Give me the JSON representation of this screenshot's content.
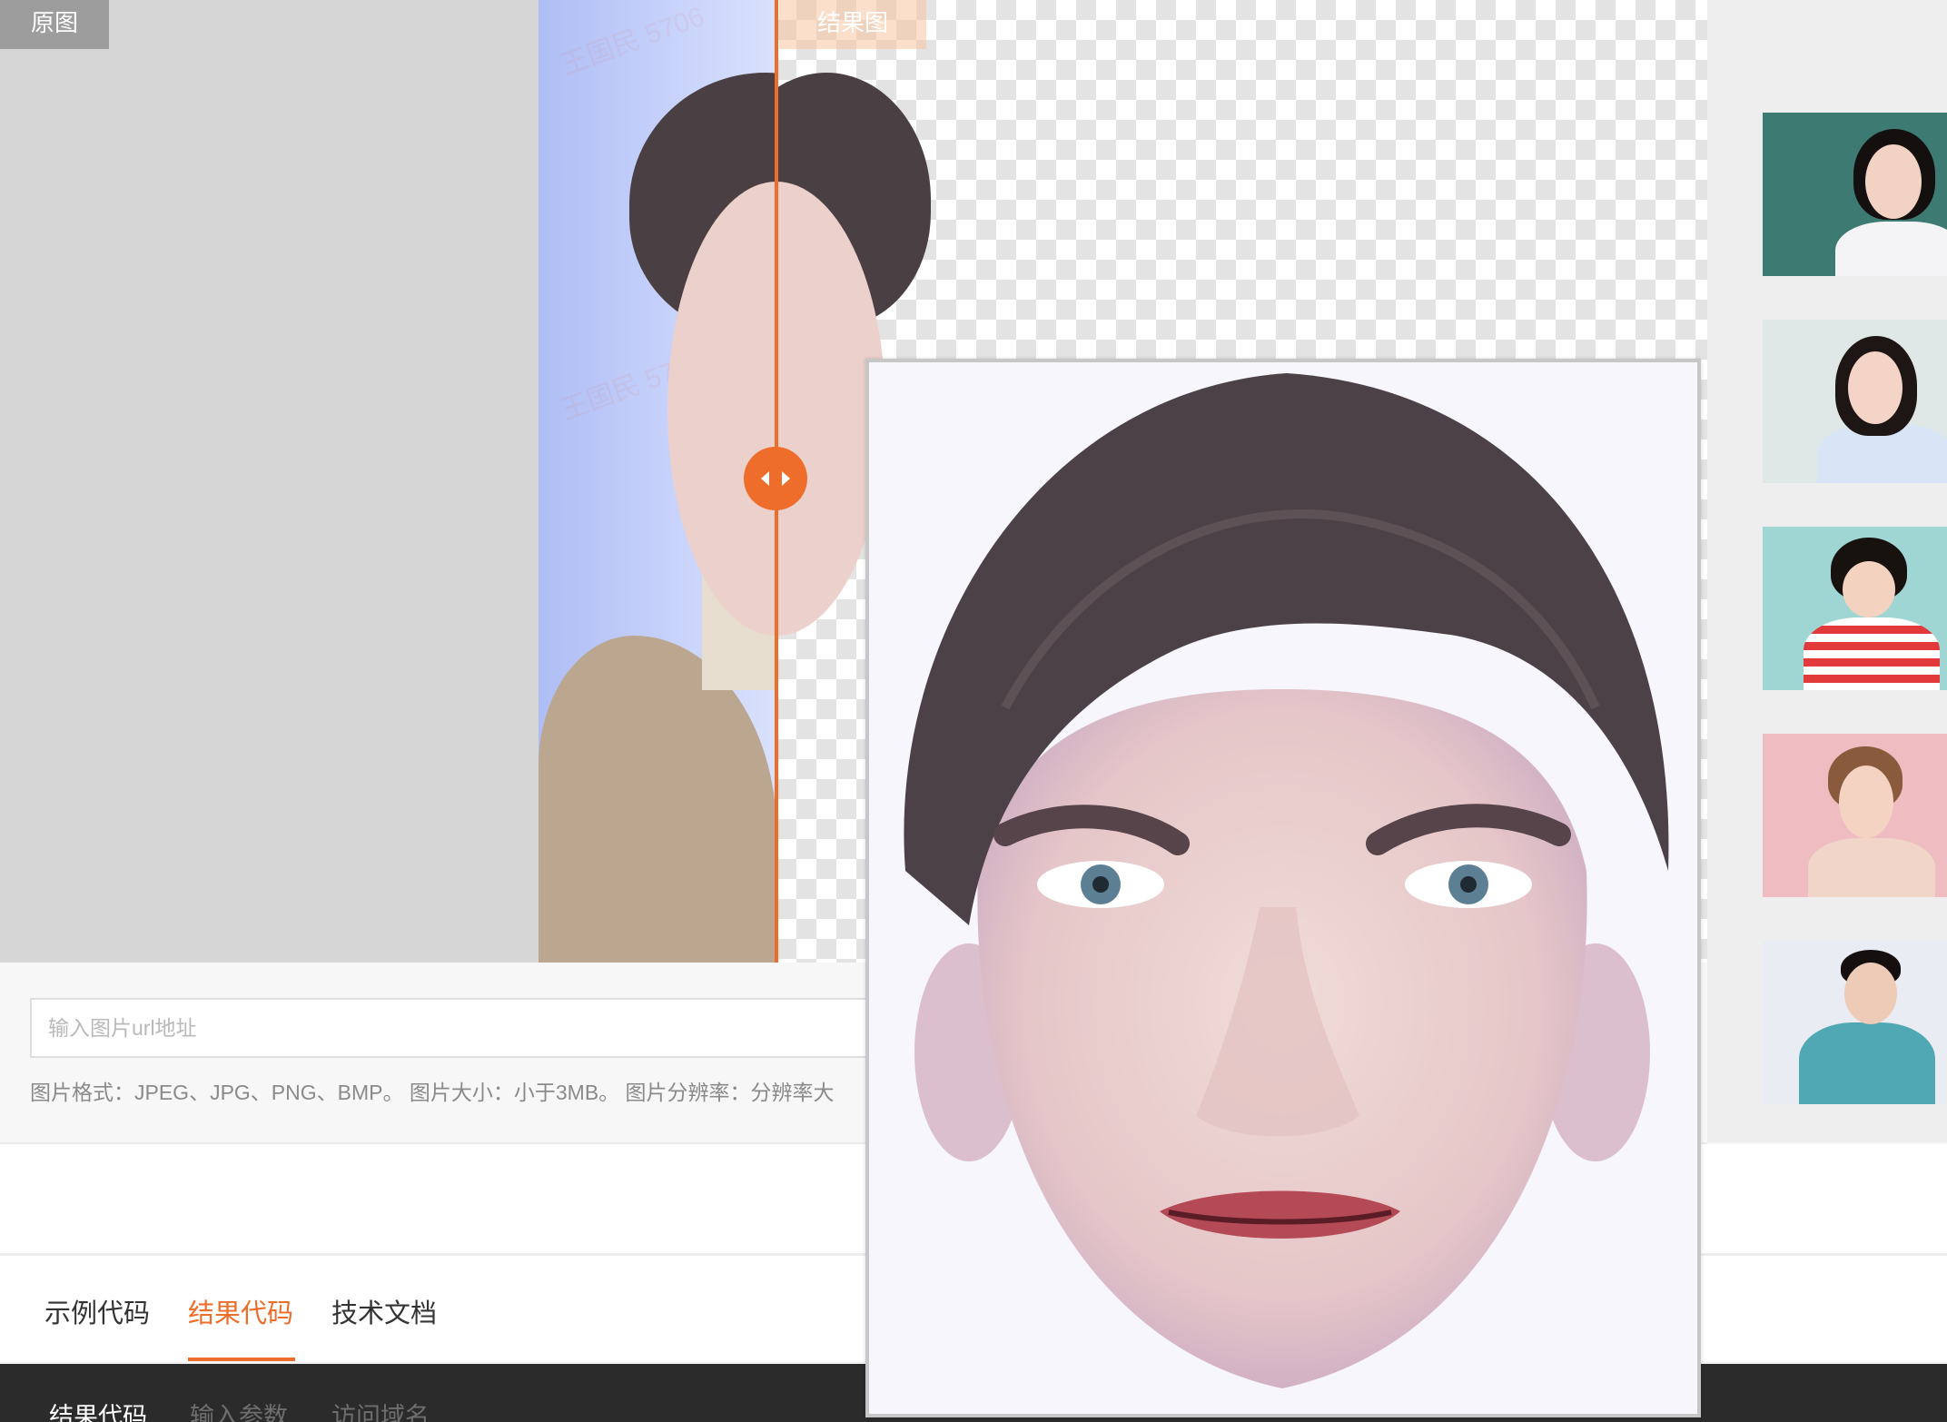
{
  "labels": {
    "original": "原图",
    "result": "结果图"
  },
  "watermark_text": "王国民 5706",
  "divider_handle": {
    "icon": "left-right-arrows-icon"
  },
  "url_input": {
    "placeholder": "输入图片url地址",
    "value": ""
  },
  "format_hint": "图片格式：JPEG、JPG、PNG、BMP。 图片大小：小于3MB。 图片分辨率：分辨率大",
  "tabs": [
    {
      "label": "示例代码",
      "active": false
    },
    {
      "label": "结果代码",
      "active": true
    },
    {
      "label": "技术文档",
      "active": false
    }
  ],
  "code_tabs": [
    {
      "label": "结果代码",
      "active": true
    },
    {
      "label": "输入参数",
      "active": false
    },
    {
      "label": "访问域名",
      "active": false
    }
  ],
  "samples": [
    {
      "name": "woman-teacher",
      "bg": "#3d7a72"
    },
    {
      "name": "woman-office",
      "bg": "#dfe8e6"
    },
    {
      "name": "girl-striped-shirt",
      "bg": "#9fd6d4"
    },
    {
      "name": "woman-pink",
      "bg": "#eebcc1"
    },
    {
      "name": "man-tailor",
      "bg": "#e9ecf3"
    }
  ],
  "colors": {
    "accent": "#ef6d2b",
    "dark_bar": "#2b2b2b"
  }
}
